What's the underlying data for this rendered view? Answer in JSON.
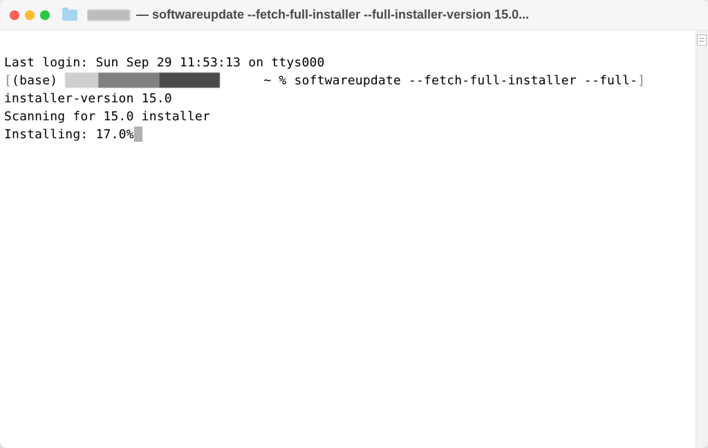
{
  "titlebar": {
    "title_cmd": " — softwareupdate --fetch-full-installer --full-installer-version 15.0..."
  },
  "terminal": {
    "last_login_prefix": "Last login: ",
    "last_login_value": "Sun Sep 29 11:53:13 on ttys000",
    "prompt_env": "(base) ",
    "prompt_suffix": " ~ % ",
    "command_part1": "softwareupdate --fetch-full-installer --full-",
    "command_part2": "installer-version 15.0",
    "scan_line": "Scanning for 15.0 installer",
    "install_label": "Installing: ",
    "install_pct": "17.0%"
  }
}
